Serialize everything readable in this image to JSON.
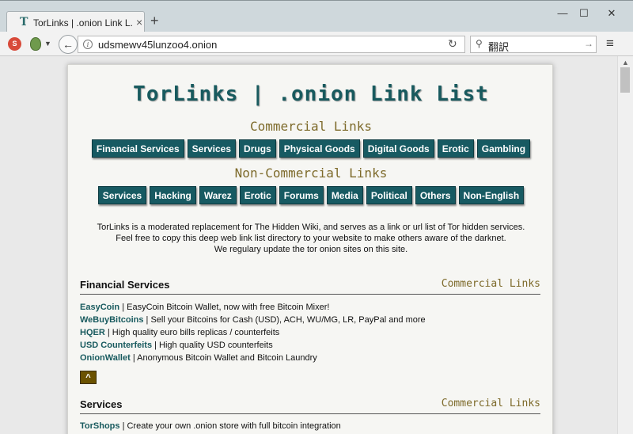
{
  "browser": {
    "tab_title": "TorLinks | .onion Link L...",
    "tab_favicon": "T",
    "tab_close": "×",
    "new_tab": "+",
    "minimize": "—",
    "maximize": "☐",
    "close": "✕",
    "noscript_label": "S",
    "back_arrow": "←",
    "url": "udsmewv45lunzoo4.onion",
    "reload": "↻",
    "search_value": "翻訳",
    "search_go": "→",
    "menu": "≡"
  },
  "page": {
    "title": "TorLinks | .onion Link List",
    "commercial_heading": "Commercial Links",
    "commercial_buttons": [
      "Financial Services",
      "Services",
      "Drugs",
      "Physical Goods",
      "Digital Goods",
      "Erotic",
      "Gambling"
    ],
    "noncommercial_heading": "Non-Commercial Links",
    "noncommercial_buttons": [
      "Services",
      "Hacking",
      "Warez",
      "Erotic",
      "Forums",
      "Media",
      "Political",
      "Others",
      "Non-English"
    ],
    "intro_lines": [
      "TorLinks is a moderated replacement for The Hidden Wiki, and serves as a link or url list of Tor hidden services.",
      "Feel free to copy this deep web link list directory to your website to make others aware of the darknet.",
      "We regulary update the tor onion sites on this site."
    ],
    "sections": [
      {
        "title": "Financial Services",
        "tag": "Commercial Links",
        "links": [
          {
            "name": "EasyCoin",
            "desc": " | EasyCoin Bitcoin Wallet, now with free Bitcoin Mixer!"
          },
          {
            "name": "WeBuyBitcoins",
            "desc": " | Sell your Bitcoins for Cash (USD), ACH, WU/MG, LR, PayPal and more"
          },
          {
            "name": "HQER",
            "desc": " | High quality euro bills replicas / counterfeits"
          },
          {
            "name": "USD Counterfeits",
            "desc": " | High quality USD counterfeits"
          },
          {
            "name": "OnionWallet",
            "desc": " | Anonymous Bitcoin Wallet and Bitcoin Laundry"
          }
        ]
      },
      {
        "title": "Services",
        "tag": "Commercial Links",
        "links": [
          {
            "name": "TorShops",
            "desc": " | Create your own .onion store with full bitcoin integration"
          }
        ]
      }
    ],
    "top_button": "^"
  }
}
